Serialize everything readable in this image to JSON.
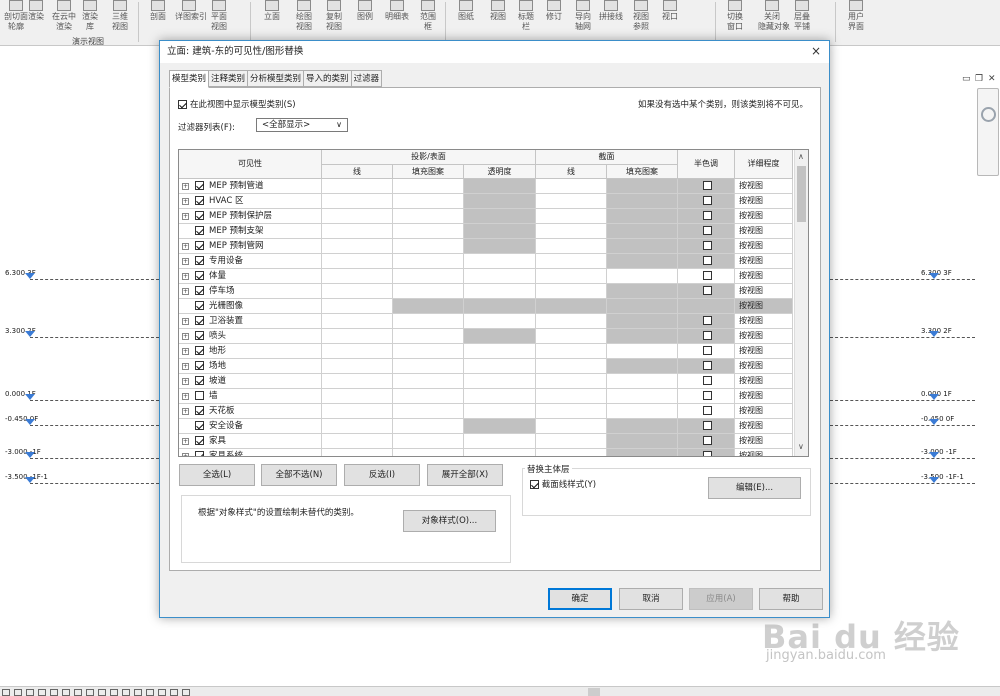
{
  "ribbon": {
    "tools": [
      {
        "label1": "剖切面",
        "label2": "轮廓",
        "icon": "section-icon"
      },
      {
        "label1": "渲染",
        "label2": "",
        "icon": "render-icon"
      },
      {
        "label1": "在云中",
        "label2": "渲染",
        "icon": "cloud-render-icon"
      },
      {
        "label1": "渲染",
        "label2": "库",
        "icon": "render-gallery-icon"
      },
      {
        "label1": "三维",
        "label2": "视图",
        "icon": "3d-view-icon"
      },
      {
        "label1": "剖面",
        "label2": "",
        "icon": "section-view-icon"
      },
      {
        "label1": "详图索引",
        "label2": "",
        "icon": "callout-icon"
      },
      {
        "label1": "平面",
        "label2": "视图",
        "icon": "plan-view-icon"
      },
      {
        "label1": "立面",
        "label2": "",
        "icon": "elevation-icon"
      },
      {
        "label1": "绘图",
        "label2": "视图",
        "icon": "drafting-view-icon"
      },
      {
        "label1": "复制",
        "label2": "视图",
        "icon": "duplicate-view-icon"
      },
      {
        "label1": "图例",
        "label2": "",
        "icon": "legend-icon"
      },
      {
        "label1": "明细表",
        "label2": "",
        "icon": "schedule-icon"
      },
      {
        "label1": "范围",
        "label2": "框",
        "icon": "scope-box-icon"
      },
      {
        "label1": "图纸",
        "label2": "",
        "icon": "sheet-icon"
      },
      {
        "label1": "视图",
        "label2": "",
        "icon": "view-icon"
      },
      {
        "label1": "标题",
        "label2": "栏",
        "icon": "title-block-icon"
      },
      {
        "label1": "修订",
        "label2": "",
        "icon": "revision-icon"
      },
      {
        "label1": "导向",
        "label2": "轴网",
        "icon": "guide-grid-icon"
      },
      {
        "label1": "拼接线",
        "label2": "",
        "icon": "matchline-icon"
      },
      {
        "label1": "视图",
        "label2": "参照",
        "icon": "view-reference-icon"
      },
      {
        "label1": "视口",
        "label2": "",
        "icon": "viewport-icon"
      },
      {
        "label1": "切换",
        "label2": "窗口",
        "icon": "switch-window-icon"
      },
      {
        "label1": "关闭",
        "label2": "隐藏对象",
        "icon": "close-hidden-icon"
      },
      {
        "label1": "层叠",
        "label2": "平铺",
        "icon": "cascade-tile-icon"
      },
      {
        "label1": "用户",
        "label2": "界面",
        "icon": "user-interface-icon"
      }
    ],
    "group_label": "演示视图"
  },
  "levels": [
    {
      "left": "6.300 3F",
      "right": "6.300 3F"
    },
    {
      "left": "3.300 2F",
      "right": "3.300 2F"
    },
    {
      "left": "0.000 1F",
      "right": "0.000 1F"
    },
    {
      "left": "-0.450 0F",
      "right": "-0.450 0F"
    },
    {
      "left": "-3.000 -1F",
      "right": "-3.000 -1F"
    },
    {
      "left": "-3.500 -1F-1",
      "right": "-3.500 -1F-1"
    }
  ],
  "dialog": {
    "title": "立面: 建筑-东的可见性/图形替换",
    "close": "×",
    "tabs": [
      "模型类别",
      "注释类别",
      "分析模型类别",
      "导入的类别",
      "过滤器"
    ],
    "show_categories_label": "在此视图中显示模型类别(S)",
    "note": "如果没有选中某个类别，则该类别将不可见。",
    "filter_list_label": "过滤器列表(F):",
    "filter_list_value": "<全部显示>",
    "headers": {
      "visibility": "可见性",
      "projection_surface": "投影/表面",
      "line": "线",
      "fill_pattern": "填充图案",
      "transparency": "透明度",
      "cut": "截面",
      "cut_line": "线",
      "cut_fill_pattern": "填充图案",
      "halftone": "半色调",
      "detail_level": "详细程度"
    },
    "rows": [
      {
        "name": "MEP 预制管道",
        "expand": true,
        "checked": true,
        "gray": [
          2,
          4,
          5
        ],
        "half": true,
        "detail": "按视图"
      },
      {
        "name": "HVAC 区",
        "expand": true,
        "checked": true,
        "gray": [
          2,
          4,
          5
        ],
        "half": true,
        "detail": "按视图"
      },
      {
        "name": "MEP 预制保护层",
        "expand": true,
        "checked": true,
        "gray": [
          2,
          4,
          5
        ],
        "half": true,
        "detail": "按视图"
      },
      {
        "name": "MEP 预制支架",
        "expand": false,
        "checked": true,
        "gray": [
          2,
          4,
          5
        ],
        "half": true,
        "detail": "按视图"
      },
      {
        "name": "MEP 预制管网",
        "expand": true,
        "checked": true,
        "gray": [
          2,
          4,
          5
        ],
        "half": true,
        "detail": "按视图"
      },
      {
        "name": "专用设备",
        "expand": true,
        "checked": true,
        "gray": [
          4,
          5
        ],
        "half": true,
        "detail": "按视图"
      },
      {
        "name": "体量",
        "expand": true,
        "checked": true,
        "gray": [],
        "half": true,
        "detail": "按视图"
      },
      {
        "name": "停车场",
        "expand": true,
        "checked": true,
        "gray": [
          4,
          5
        ],
        "half": true,
        "detail": "按视图"
      },
      {
        "name": "光栅图像",
        "expand": false,
        "checked": true,
        "gray": [
          1,
          2,
          3,
          4,
          5,
          6
        ],
        "half": false,
        "detail": "按视图"
      },
      {
        "name": "卫浴装置",
        "expand": true,
        "checked": true,
        "gray": [
          4,
          5
        ],
        "half": true,
        "detail": "按视图"
      },
      {
        "name": "喷头",
        "expand": true,
        "checked": true,
        "gray": [
          2,
          4,
          5
        ],
        "half": true,
        "detail": "按视图"
      },
      {
        "name": "地形",
        "expand": true,
        "checked": true,
        "gray": [],
        "half": true,
        "detail": "按视图"
      },
      {
        "name": "场地",
        "expand": true,
        "checked": true,
        "gray": [
          4,
          5
        ],
        "half": true,
        "detail": "按视图"
      },
      {
        "name": "坡道",
        "expand": true,
        "checked": true,
        "gray": [],
        "half": true,
        "detail": "按视图"
      },
      {
        "name": "墙",
        "expand": true,
        "checked": false,
        "gray": [],
        "half": true,
        "detail": "按视图"
      },
      {
        "name": "天花板",
        "expand": true,
        "checked": true,
        "gray": [],
        "half": true,
        "detail": "按视图"
      },
      {
        "name": "安全设备",
        "expand": false,
        "checked": true,
        "gray": [
          2,
          4,
          5
        ],
        "half": true,
        "detail": "按视图"
      },
      {
        "name": "家具",
        "expand": true,
        "checked": true,
        "gray": [
          4,
          5
        ],
        "half": true,
        "detail": "按视图"
      },
      {
        "name": "家具系统",
        "expand": true,
        "checked": true,
        "gray": [
          4,
          5
        ],
        "half": true,
        "detail": "按视图"
      }
    ],
    "buttons": {
      "select_all": "全选(L)",
      "select_none": "全部不选(N)",
      "invert": "反选(I)",
      "expand_all": "展开全部(X)",
      "edit": "编辑(E)...",
      "object_styles": "对象样式(O)...",
      "ok": "确定",
      "cancel": "取消",
      "apply": "应用(A)",
      "help": "帮助"
    },
    "host_layers_label": "替换主体层",
    "cut_line_styles_label": "截面线样式(Y)",
    "object_styles_note": "根据\"对象样式\"的设置绘制未替代的类别。"
  },
  "watermark": {
    "brand": "Bai du 经验",
    "url": "jingyan.baidu.com"
  },
  "colors": {
    "accent": "#0078d7",
    "gray_cell": "#c1c1c1",
    "level_marker": "#3a7bd5"
  }
}
